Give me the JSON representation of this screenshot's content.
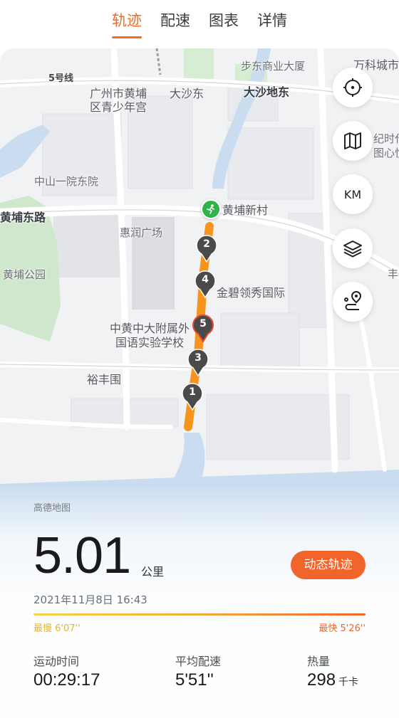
{
  "tabs": [
    {
      "label": "轨迹",
      "active": true
    },
    {
      "label": "配速",
      "active": false
    },
    {
      "label": "图表",
      "active": false
    },
    {
      "label": "详情",
      "active": false
    }
  ],
  "map": {
    "labels": {
      "line5": "5号线",
      "youth_palace_1": "广州市黄埔",
      "youth_palace_2": "区青少年宫",
      "dashadong": "大沙东",
      "dashadi_east": "大沙地东",
      "budong_plaza": "步东商业大厦",
      "wanke": "万科城市",
      "right_edge_1": "纪时代",
      "right_edge_2": "图心悦",
      "zhongshan_hospital": "中山一院东院",
      "huangpu_east_road": "黄埔东路",
      "huangpu_xincun": "黄埔新村",
      "huirun_plaza": "惠润广场",
      "huangpu_park": "黄埔公园",
      "jinbi": "金碧领秀国际",
      "school_1": "中黄中大附属外",
      "school_2": "国语实验学校",
      "yufengwei": "裕丰围",
      "right_edge_3": "丰"
    },
    "controls": {
      "locate_icon": "crosshair-icon",
      "map_type_icon": "map-icon",
      "km_label": "KM",
      "layers_icon": "layers-icon",
      "route_icon": "route-pin-icon"
    },
    "markers": [
      "2",
      "4",
      "5",
      "3",
      "1"
    ],
    "route_color": "#f7941d"
  },
  "summary": {
    "map_provider": "高德地图",
    "distance": "5.01",
    "distance_unit": "公里",
    "dynamic_track_label": "动态轨迹",
    "datetime": "2021年11月8日 16:43",
    "slowest": "最慢 6'07''",
    "fastest": "最快 5'26''",
    "stats": [
      {
        "label": "运动时间",
        "value": "00:29:17",
        "unit": ""
      },
      {
        "label": "平均配速",
        "value": "5'51''",
        "unit": ""
      },
      {
        "label": "热量",
        "value": "298",
        "unit": "千卡"
      }
    ]
  },
  "colors": {
    "accent": "#f26a24",
    "start_green": "#2fb34a",
    "slow_yellow": "#e4b62a"
  }
}
